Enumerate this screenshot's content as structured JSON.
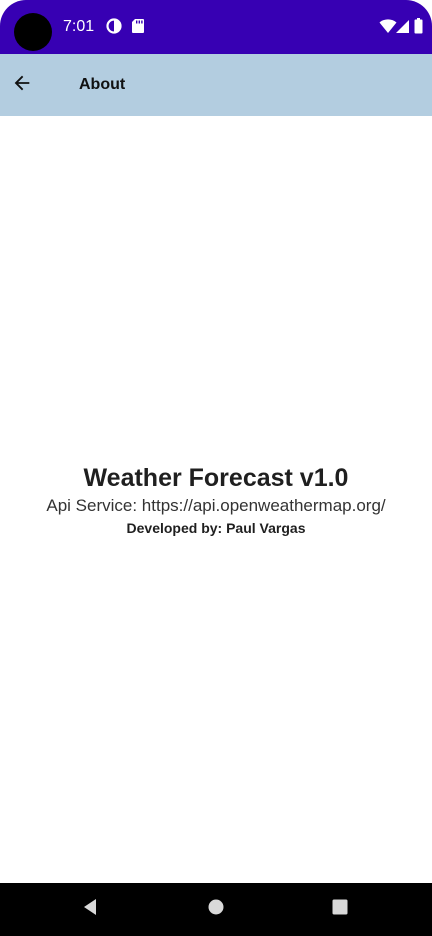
{
  "status_bar": {
    "time": "7:01",
    "left_icons": [
      "data-saver-icon",
      "sd-card-icon"
    ],
    "right_icons": [
      "wifi-icon",
      "signal-icon",
      "battery-icon"
    ],
    "color": "#3700b3"
  },
  "app_bar": {
    "title": "About",
    "back_icon": "arrow-left-icon",
    "color": "#b3cde0"
  },
  "about": {
    "app_name": "Weather Forecast v1.0",
    "api_service": "Api Service: https://api.openweathermap.org/",
    "developer": "Developed by: Paul Vargas"
  },
  "nav_bar": {
    "buttons": [
      "back-triangle-icon",
      "home-circle-icon",
      "recents-square-icon"
    ]
  }
}
